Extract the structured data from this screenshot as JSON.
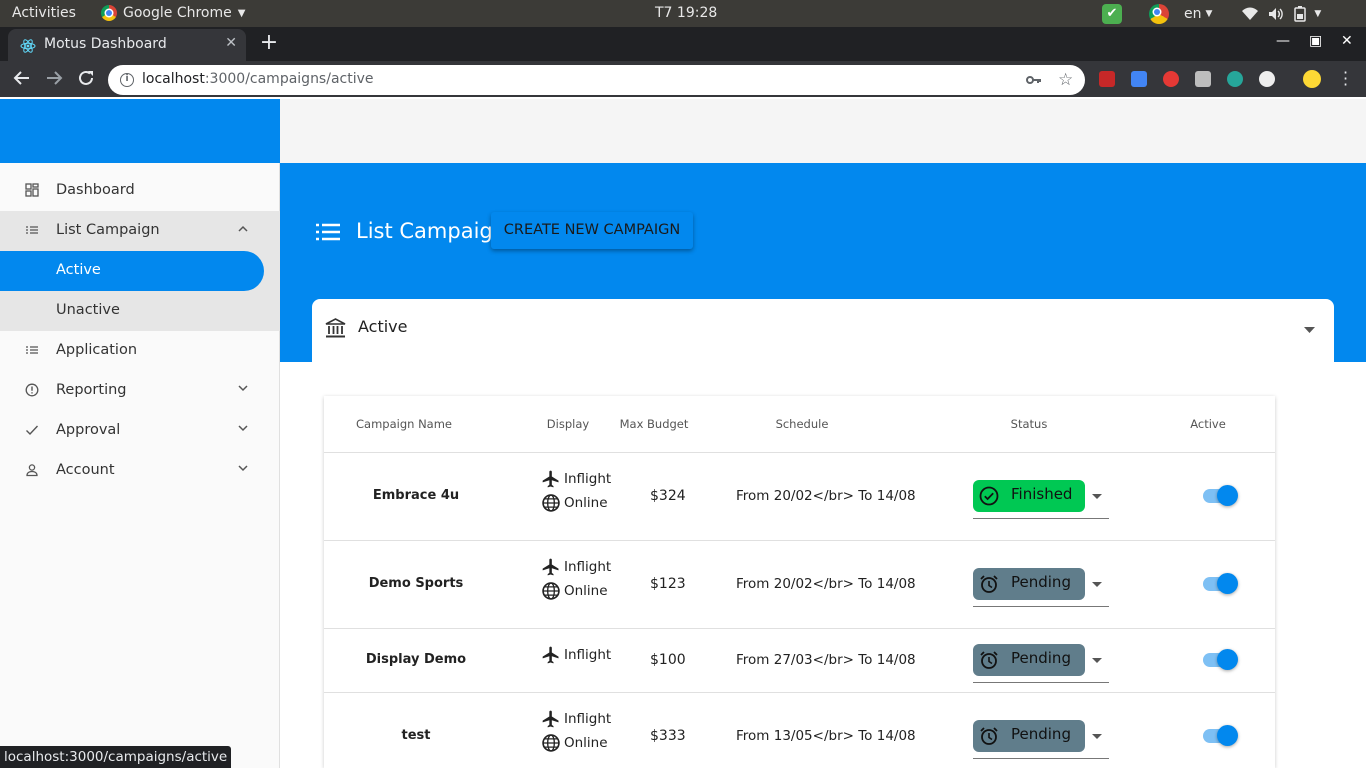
{
  "gnome": {
    "activities": "Activities",
    "app_name": "Google Chrome",
    "clock": "T7 19:28",
    "lang": "en"
  },
  "browser": {
    "tab_title": "Motus Dashboard",
    "url_host": "localhost",
    "url_path": ":3000/campaigns/active",
    "status_url": "localhost:3000/campaigns/active"
  },
  "sidebar": {
    "items": [
      {
        "label": "Dashboard",
        "icon": "dashboard-icon"
      },
      {
        "label": "List Campaign",
        "icon": "list-icon"
      },
      {
        "label": "Application",
        "icon": "list-icon"
      },
      {
        "label": "Reporting",
        "icon": "info-icon"
      },
      {
        "label": "Approval",
        "icon": "check-icon"
      },
      {
        "label": "Account",
        "icon": "person-icon"
      }
    ],
    "sub_items": [
      {
        "label": "Active"
      },
      {
        "label": "Unactive"
      }
    ]
  },
  "page": {
    "title": "List Campaign",
    "create_button": "CREATE NEW CAMPAIGN",
    "card_title": "Active"
  },
  "table": {
    "headers": [
      "Campaign Name",
      "Display",
      "Max Budget",
      "Schedule",
      "Status",
      "Active"
    ],
    "rows": [
      {
        "name": "Embrace 4u",
        "inflight": "Inflight",
        "online": "Online",
        "budget": "$324",
        "schedule": "From 20/02</br> To 14/08",
        "status": "Finished",
        "active": true
      },
      {
        "name": "Demo Sports",
        "inflight": "Inflight",
        "online": "Online",
        "budget": "$123",
        "schedule": "From 20/02</br> To 14/08",
        "status": "Pending",
        "active": true
      },
      {
        "name": "Display Demo",
        "inflight": "Inflight",
        "budget": "$100",
        "schedule": "From 27/03</br> To 14/08",
        "status": "Pending",
        "active": true
      },
      {
        "name": "test",
        "inflight": "Inflight",
        "online": "Online",
        "budget": "$333",
        "schedule": "From 13/05</br> To 14/08",
        "status": "Pending",
        "active": true
      }
    ]
  },
  "colors": {
    "primary": "#0288ee",
    "finished": "#00c853",
    "pending": "#607d8b"
  }
}
